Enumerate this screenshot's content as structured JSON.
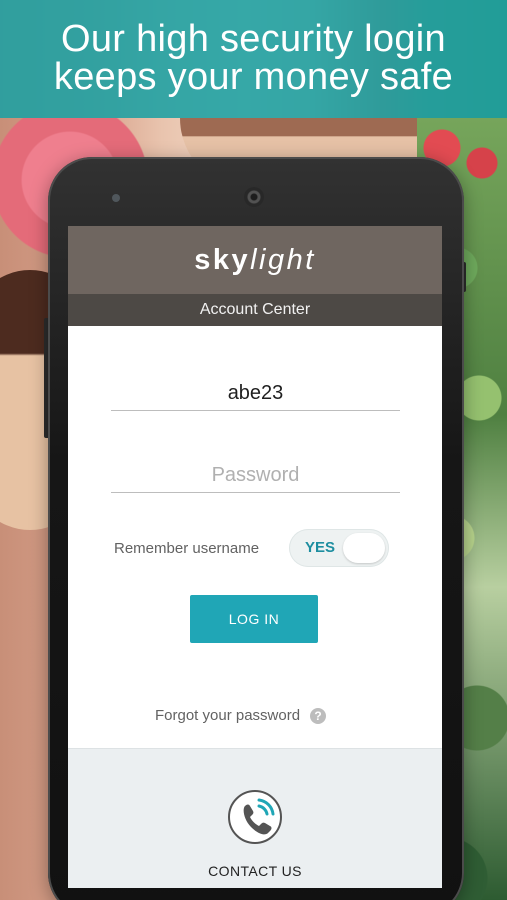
{
  "banner": {
    "line1": "Our high security login",
    "line2": "keeps your money safe"
  },
  "app": {
    "brand": {
      "bold": "sky",
      "light": "light"
    },
    "subtitle": "Account Center",
    "username": {
      "value": "abe23"
    },
    "password": {
      "placeholder": "Password"
    },
    "remember": {
      "label": "Remember username",
      "toggle_text": "YES"
    },
    "login_button": "LOG IN",
    "forgot": {
      "label": "Forgot your password",
      "icon": "?"
    },
    "contact": {
      "label": "CONTACT US",
      "icon": "phone-call-icon"
    }
  },
  "colors": {
    "accent": "#20a6b6",
    "banner": "#1ba0a3",
    "header": "#6f6660",
    "subheader": "#4d4945"
  }
}
